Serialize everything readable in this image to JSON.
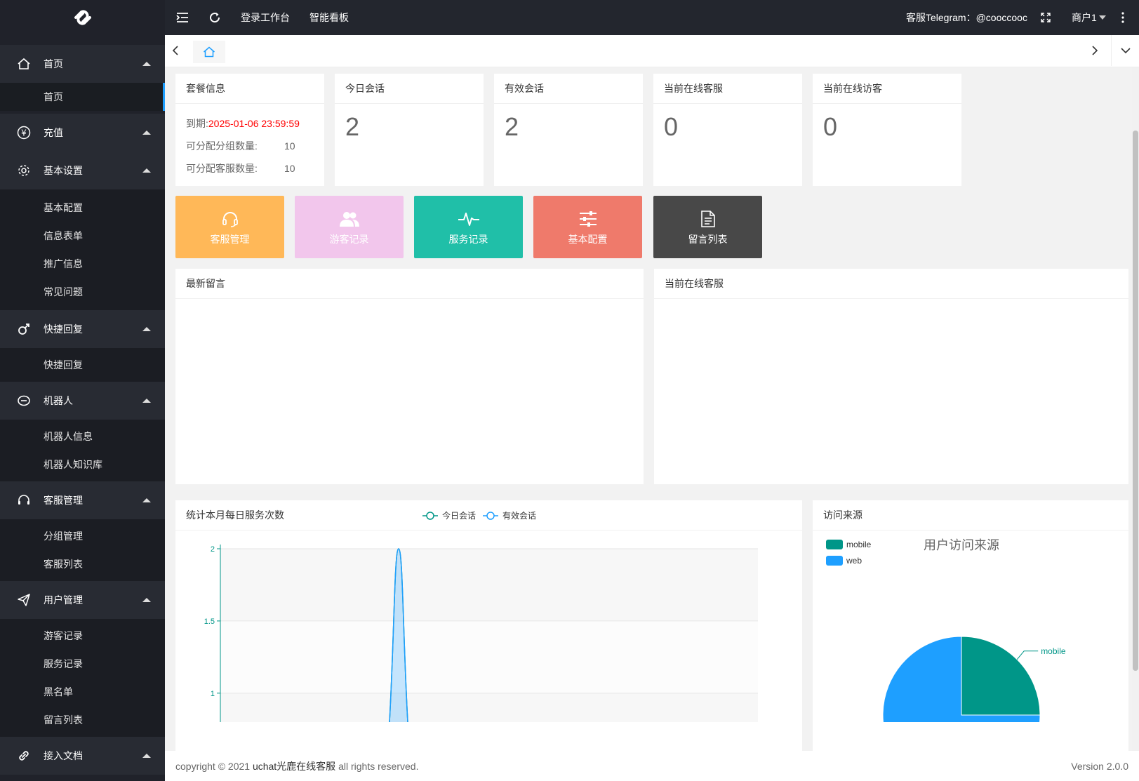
{
  "header": {
    "links": [
      "登录工作台",
      "智能看板"
    ],
    "telegram_label": "客服Telegram：",
    "telegram_handle": "@cooccooc",
    "user": "商户1"
  },
  "sidebar": {
    "groups": [
      {
        "label": "首页",
        "icon": "home-icon",
        "items": [
          "首页"
        ]
      },
      {
        "label": "充值",
        "icon": "yen-icon",
        "items": []
      },
      {
        "label": "基本设置",
        "icon": "gear-icon",
        "items": [
          "基本配置",
          "信息表单",
          "推广信息",
          "常见问题"
        ]
      },
      {
        "label": "快捷回复",
        "icon": "male-icon",
        "items": [
          "快捷回复"
        ]
      },
      {
        "label": "机器人",
        "icon": "robot-icon",
        "items": [
          "机器人信息",
          "机器人知识库"
        ]
      },
      {
        "label": "客服管理",
        "icon": "headset-icon",
        "items": [
          "分组管理",
          "客服列表"
        ]
      },
      {
        "label": "用户管理",
        "icon": "paper-plane-icon",
        "items": [
          "游客记录",
          "服务记录",
          "黑名单",
          "留言列表"
        ]
      },
      {
        "label": "接入文档",
        "icon": "link-icon",
        "items": []
      }
    ]
  },
  "stats": {
    "package": {
      "title": "套餐信息",
      "expire_label": "到期:",
      "expire_value": "2025-01-06 23:59:59",
      "groups_label": "可分配分组数量:",
      "groups_value": "10",
      "agents_label": "可分配客服数量:",
      "agents_value": "10"
    },
    "cards": [
      {
        "title": "今日会话",
        "value": "2"
      },
      {
        "title": "有效会话",
        "value": "2"
      },
      {
        "title": "当前在线客服",
        "value": "0"
      },
      {
        "title": "当前在线访客",
        "value": "0"
      }
    ]
  },
  "quick": [
    {
      "label": "客服管理",
      "icon": "headset-icon",
      "color": "#ffb858"
    },
    {
      "label": "游客记录",
      "icon": "users-icon",
      "color": "#f2c6ec"
    },
    {
      "label": "服务记录",
      "icon": "pulse-icon",
      "color": "#20bfa8"
    },
    {
      "label": "基本配置",
      "icon": "sliders-icon",
      "color": "#ef7a6b"
    },
    {
      "label": "留言列表",
      "icon": "document-icon",
      "color": "#484848"
    }
  ],
  "panels": {
    "messages_title": "最新留言",
    "online_title": "当前在线客服",
    "line_title": "统计本月每日服务次数",
    "pie_title": "访问来源"
  },
  "chart_data": [
    {
      "type": "line",
      "title": "",
      "legend": [
        "今日会话",
        "有效会话"
      ],
      "legend_position": "top-center",
      "yticks": [
        "2",
        "1.5",
        "1"
      ],
      "ylim_visible": [
        0.8,
        2
      ],
      "series": [
        {
          "name": "今日会话",
          "peak_value": 2
        },
        {
          "name": "有效会话",
          "peak_value": 2
        }
      ],
      "grid": true
    },
    {
      "type": "pie",
      "title": "用户访问来源",
      "legend": [
        "mobile",
        "web"
      ],
      "legend_position": "top-left",
      "slices": [
        {
          "name": "mobile",
          "value": 1,
          "color": "#009688"
        },
        {
          "name": "web",
          "value": 3,
          "color": "#1e9fff"
        }
      ]
    }
  ],
  "footer": {
    "copyright_prefix": "copyright © 2021",
    "brand": "uchat光鹿在线客服",
    "copyright_suffix": "all rights reserved.",
    "version": "Version 2.0.0"
  }
}
